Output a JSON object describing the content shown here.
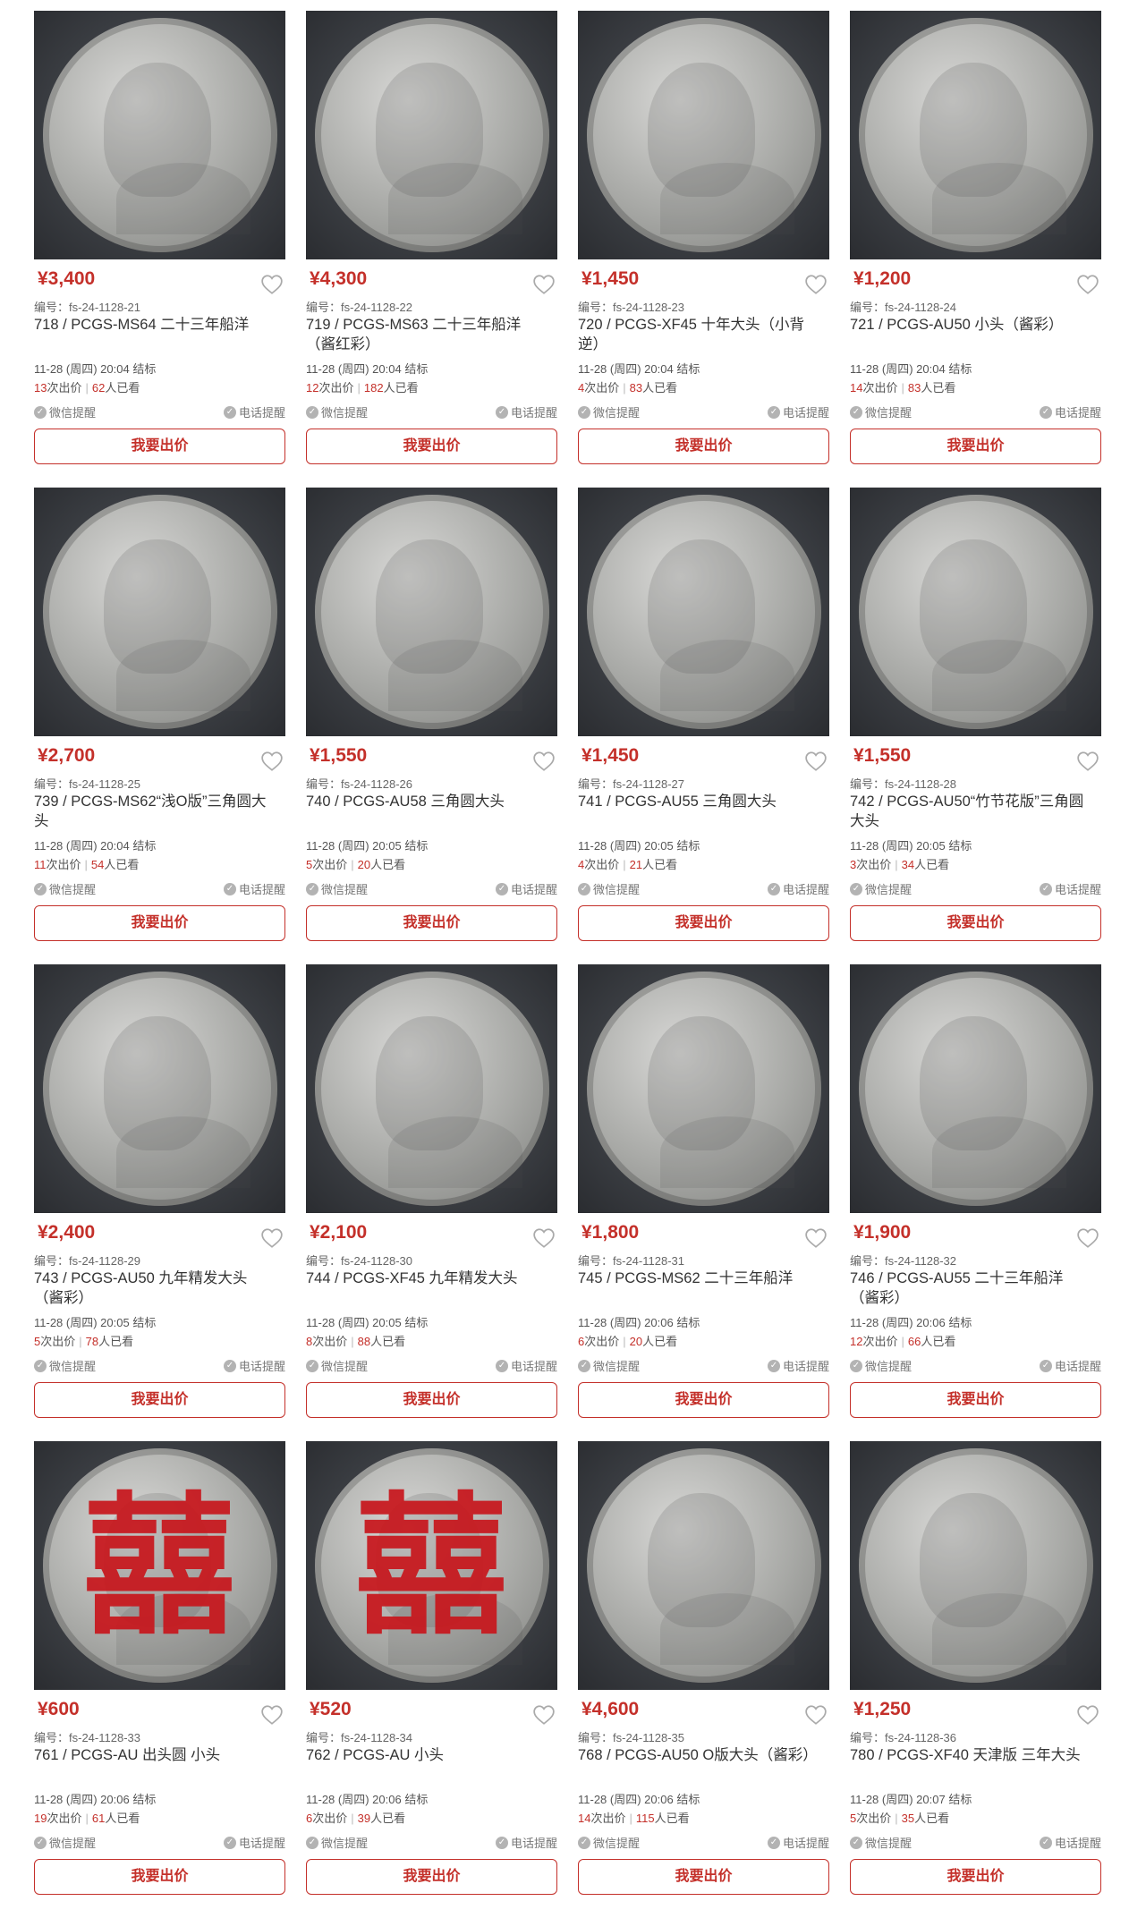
{
  "labels": {
    "code_prefix": "编号：",
    "end_suffix": "结标",
    "bids_suffix": "次出价",
    "views_suffix": "人已看",
    "wechat_remind": "微信提醒",
    "phone_remind": "电话提醒",
    "bid_button": "我要出价"
  },
  "colors": {
    "accent": "#c4302a"
  },
  "items": [
    {
      "price": "¥3,400",
      "code": "fs-24-1128-21",
      "title": "718 / PCGS-MS64 二十三年船洋",
      "end": "11-28 (周四) 20:04",
      "bids": "13",
      "views": "62",
      "seal": false
    },
    {
      "price": "¥4,300",
      "code": "fs-24-1128-22",
      "title": "719 / PCGS-MS63 二十三年船洋（酱红彩）",
      "end": "11-28 (周四) 20:04",
      "bids": "12",
      "views": "182",
      "seal": false
    },
    {
      "price": "¥1,450",
      "code": "fs-24-1128-23",
      "title": "720 / PCGS-XF45 十年大头（小背逆）",
      "end": "11-28 (周四) 20:04",
      "bids": "4",
      "views": "83",
      "seal": false
    },
    {
      "price": "¥1,200",
      "code": "fs-24-1128-24",
      "title": "721 / PCGS-AU50 小头（酱彩）",
      "end": "11-28 (周四) 20:04",
      "bids": "14",
      "views": "83",
      "seal": false
    },
    {
      "price": "¥2,700",
      "code": "fs-24-1128-25",
      "title": "739 / PCGS-MS62“浅O版”三角圆大头",
      "end": "11-28 (周四) 20:04",
      "bids": "11",
      "views": "54",
      "seal": false
    },
    {
      "price": "¥1,550",
      "code": "fs-24-1128-26",
      "title": "740 / PCGS-AU58 三角圆大头",
      "end": "11-28 (周四) 20:05",
      "bids": "5",
      "views": "20",
      "seal": false
    },
    {
      "price": "¥1,450",
      "code": "fs-24-1128-27",
      "title": "741 / PCGS-AU55 三角圆大头",
      "end": "11-28 (周四) 20:05",
      "bids": "4",
      "views": "21",
      "seal": false
    },
    {
      "price": "¥1,550",
      "code": "fs-24-1128-28",
      "title": "742 / PCGS-AU50“竹节花版”三角圆大头",
      "end": "11-28 (周四) 20:05",
      "bids": "3",
      "views": "34",
      "seal": false
    },
    {
      "price": "¥2,400",
      "code": "fs-24-1128-29",
      "title": "743 / PCGS-AU50 九年精发大头（酱彩）",
      "end": "11-28 (周四) 20:05",
      "bids": "5",
      "views": "78",
      "seal": false
    },
    {
      "price": "¥2,100",
      "code": "fs-24-1128-30",
      "title": "744 / PCGS-XF45 九年精发大头",
      "end": "11-28 (周四) 20:05",
      "bids": "8",
      "views": "88",
      "seal": false
    },
    {
      "price": "¥1,800",
      "code": "fs-24-1128-31",
      "title": "745 / PCGS-MS62 二十三年船洋",
      "end": "11-28 (周四) 20:06",
      "bids": "6",
      "views": "20",
      "seal": false
    },
    {
      "price": "¥1,900",
      "code": "fs-24-1128-32",
      "title": "746 / PCGS-AU55 二十三年船洋（酱彩）",
      "end": "11-28 (周四) 20:06",
      "bids": "12",
      "views": "66",
      "seal": false
    },
    {
      "price": "¥600",
      "code": "fs-24-1128-33",
      "title": "761 / PCGS-AU 出头圆 小头",
      "end": "11-28 (周四) 20:06",
      "bids": "19",
      "views": "61",
      "seal": true
    },
    {
      "price": "¥520",
      "code": "fs-24-1128-34",
      "title": "762 / PCGS-AU 小头",
      "end": "11-28 (周四) 20:06",
      "bids": "6",
      "views": "39",
      "seal": true
    },
    {
      "price": "¥4,600",
      "code": "fs-24-1128-35",
      "title": "768 / PCGS-AU50 O版大头（酱彩）",
      "end": "11-28 (周四) 20:06",
      "bids": "14",
      "views": "115",
      "seal": false
    },
    {
      "price": "¥1,250",
      "code": "fs-24-1128-36",
      "title": "780 / PCGS-XF40 天津版 三年大头",
      "end": "11-28 (周四) 20:07",
      "bids": "5",
      "views": "35",
      "seal": false
    }
  ]
}
